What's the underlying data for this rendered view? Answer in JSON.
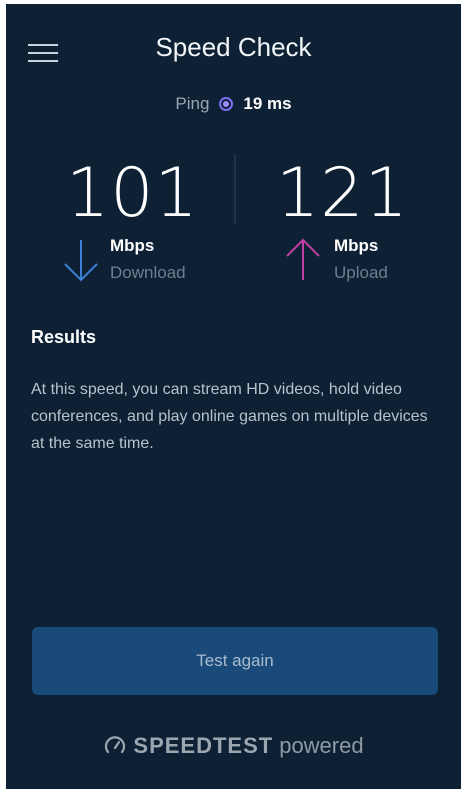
{
  "header": {
    "title": "Speed Check",
    "menu_icon": "hamburger-menu-icon"
  },
  "ping": {
    "label": "Ping",
    "value": "19 ms",
    "dot_color": "#8a76ff"
  },
  "download": {
    "value": "101",
    "unit": "Mbps",
    "label": "Download",
    "icon": "arrow-down-icon",
    "color": "#3e7fd6"
  },
  "upload": {
    "value": "121",
    "unit": "Mbps",
    "label": "Upload",
    "icon": "arrow-up-icon",
    "color": "#c23fa8"
  },
  "results": {
    "heading": "Results",
    "text": "At this speed, you can stream HD videos, hold video conferences, and play online games on multiple devices at the same time."
  },
  "actions": {
    "test_again_label": "Test again"
  },
  "footer": {
    "brand": "SPEEDTEST",
    "powered": "powered",
    "icon": "speedometer-icon"
  },
  "colors": {
    "background": "#0d2034",
    "button": "#1a4a7a"
  }
}
